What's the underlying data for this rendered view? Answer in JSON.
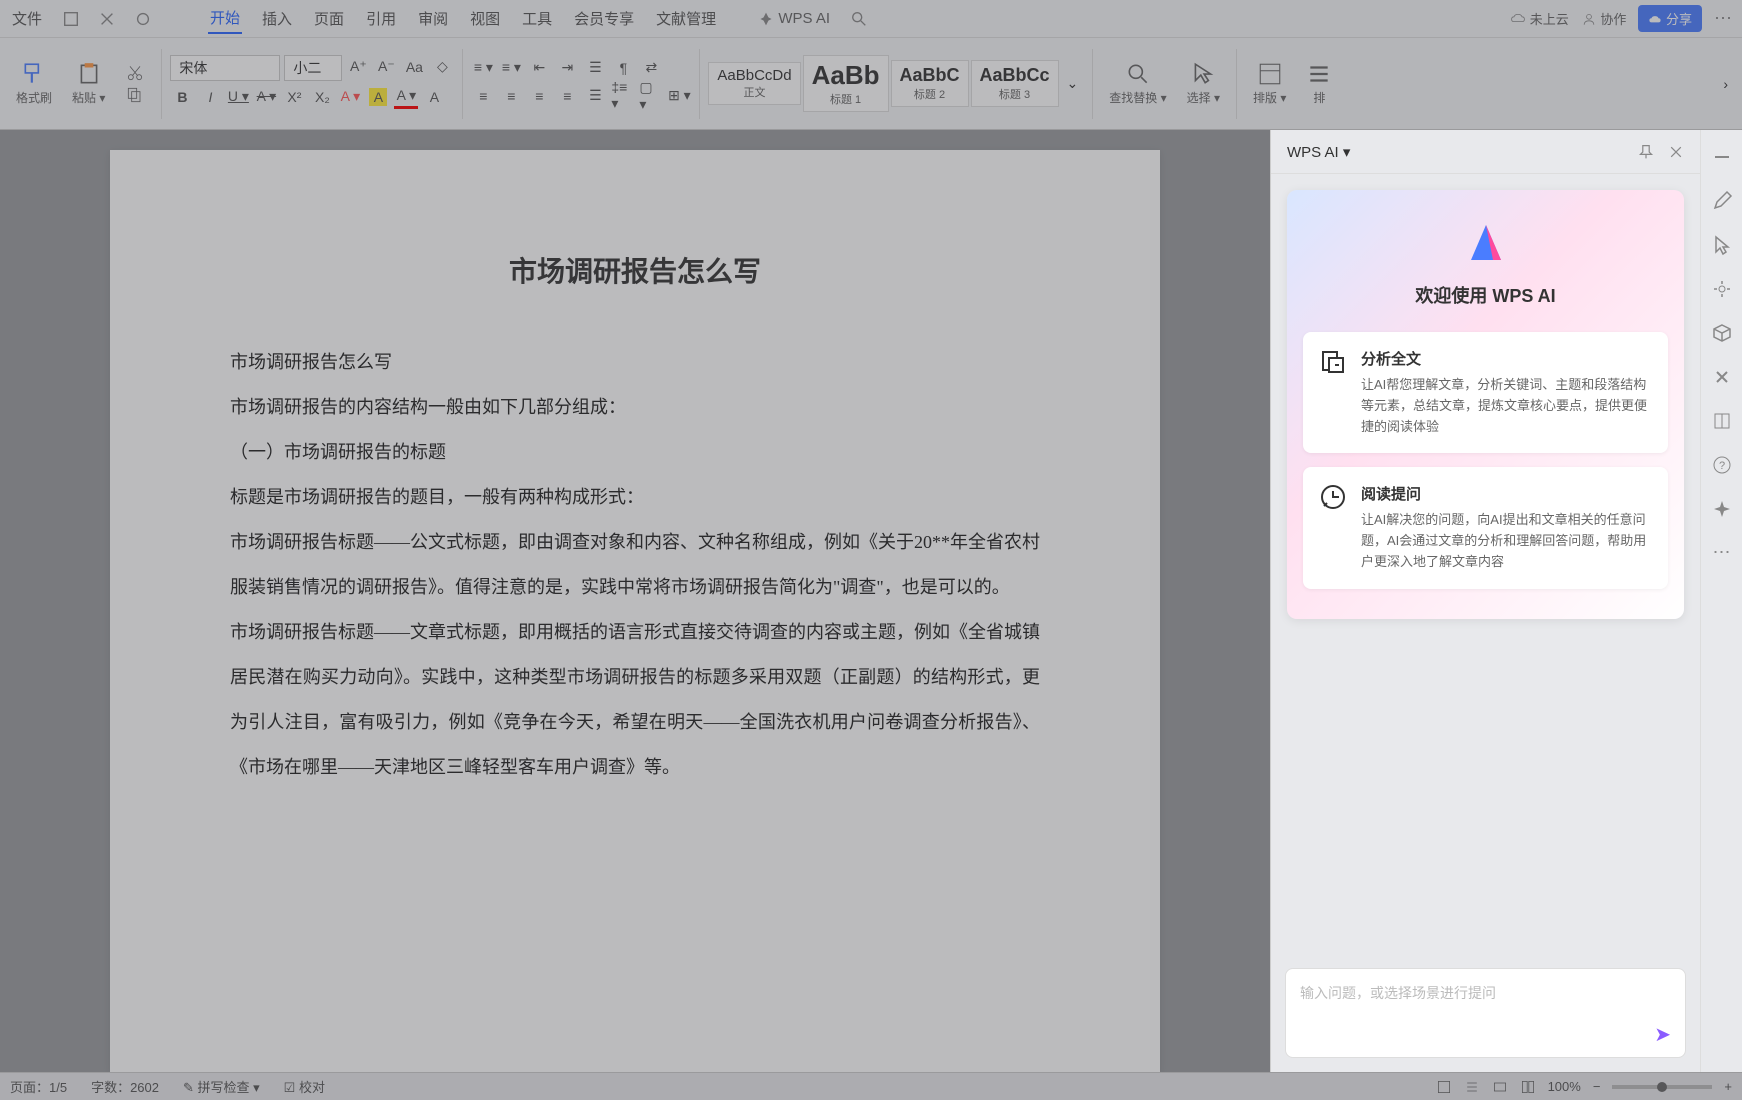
{
  "menubar": {
    "file": "文件",
    "tabs": [
      "开始",
      "插入",
      "页面",
      "引用",
      "审阅",
      "视图",
      "工具",
      "会员专享",
      "文献管理"
    ],
    "active_index": 0,
    "wps_ai": "WPS AI",
    "not_cloud": "未上云",
    "collab": "协作",
    "share": "分享"
  },
  "ribbon": {
    "format_painter": "格式刷",
    "paste": "粘贴",
    "font_name": "宋体",
    "font_size": "小二",
    "styles": [
      {
        "preview": "AaBbCcDd",
        "name": "正文",
        "cls": ""
      },
      {
        "preview": "AaBb",
        "name": "标题 1",
        "cls": "large"
      },
      {
        "preview": "AaBbC",
        "name": "标题 2",
        "cls": "med"
      },
      {
        "preview": "AaBbCc",
        "name": "标题 3",
        "cls": "med"
      }
    ],
    "find_replace": "查找替换",
    "select": "选择",
    "layout": "排版",
    "layout2": "排"
  },
  "document": {
    "title": "市场调研报告怎么写",
    "paragraphs": [
      "市场调研报告怎么写",
      "市场调研报告的内容结构一般由如下几部分组成：",
      "（一）市场调研报告的标题",
      "标题是市场调研报告的题目，一般有两种构成形式：",
      "市场调研报告标题——公文式标题，即由调查对象和内容、文种名称组成，例如《关于20**年全省农村服装销售情况的调研报告》。值得注意的是，实践中常将市场调研报告简化为\"调查\"，也是可以的。",
      "市场调研报告标题——文章式标题，即用概括的语言形式直接交待调查的内容或主题，例如《全省城镇居民潜在购买力动向》。实践中，这种类型市场调研报告的标题多采用双题（正副题）的结构形式，更为引人注目，富有吸引力，例如《竞争在今天，希望在明天——全国洗衣机用户问卷调查分析报告》、《市场在哪里——天津地区三峰轻型客车用户调查》等。"
    ]
  },
  "ai_panel": {
    "title": "WPS AI",
    "welcome": "欢迎使用 WPS AI",
    "options": [
      {
        "title": "分析全文",
        "desc": "让AI帮您理解文章，分析关键词、主题和段落结构等元素，总结文章，提炼文章核心要点，提供更便捷的阅读体验"
      },
      {
        "title": "阅读提问",
        "desc": "让AI解决您的问题，向AI提出和文章相关的任意问题，AI会通过文章的分析和理解回答问题，帮助用户更深入地了解文章内容"
      }
    ],
    "input_placeholder": "输入问题，或选择场景进行提问"
  },
  "statusbar": {
    "page": "页面：1/5",
    "words": "字数：2602",
    "spellcheck": "拼写检查",
    "proofread": "校对",
    "zoom": "100%"
  }
}
